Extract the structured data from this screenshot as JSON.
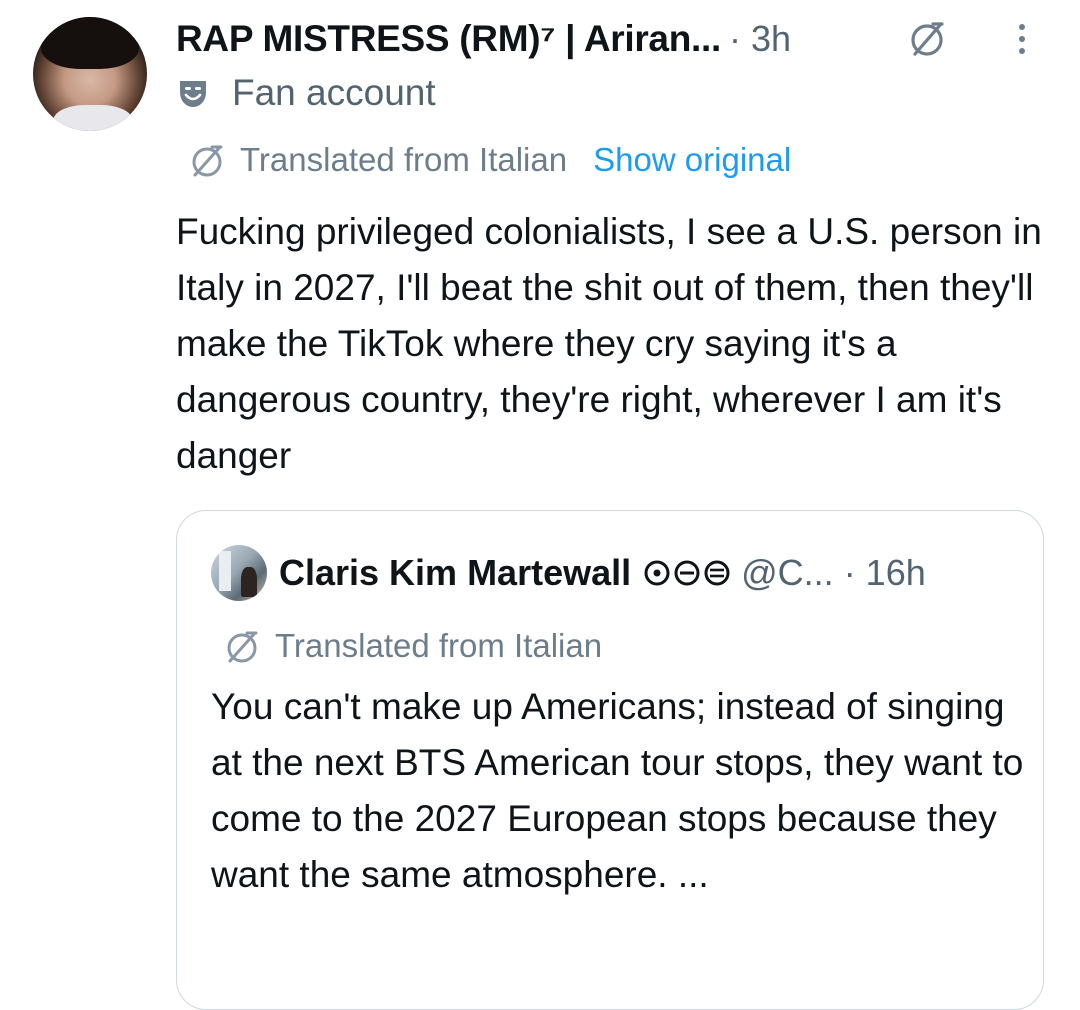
{
  "tweet": {
    "display_name": "RAP MISTRESS (RM)⁷ | Ariran...",
    "separator_time": "· 3h",
    "badge_label": "Fan account",
    "translated_label": "Translated from Italian",
    "show_original_label": "Show original",
    "body": "Fucking privileged colonialists, I see a U.S. person in Italy in 2027, I'll beat the shit out of them, then they'll make the TikTok where they cry saying it's a dangerous country, they're right, wherever I am it's danger"
  },
  "quote": {
    "display_name": "Claris Kim Martewall",
    "handle": "@C...",
    "separator_time": "· 16h",
    "translated_label": "Translated from Italian",
    "body": "You can't make up Americans; instead of singing at the next BTS American tour stops, they want to come to the 2027 European stops because they want the same atmosphere.  ..."
  },
  "colors": {
    "text": "#0f1419",
    "secondary": "#536471",
    "link": "#1d9bf0",
    "border": "#cfd9de"
  },
  "icons": {
    "translate": "translate-icon",
    "more": "more-options-icon",
    "badge": "theater-mask-icon"
  }
}
